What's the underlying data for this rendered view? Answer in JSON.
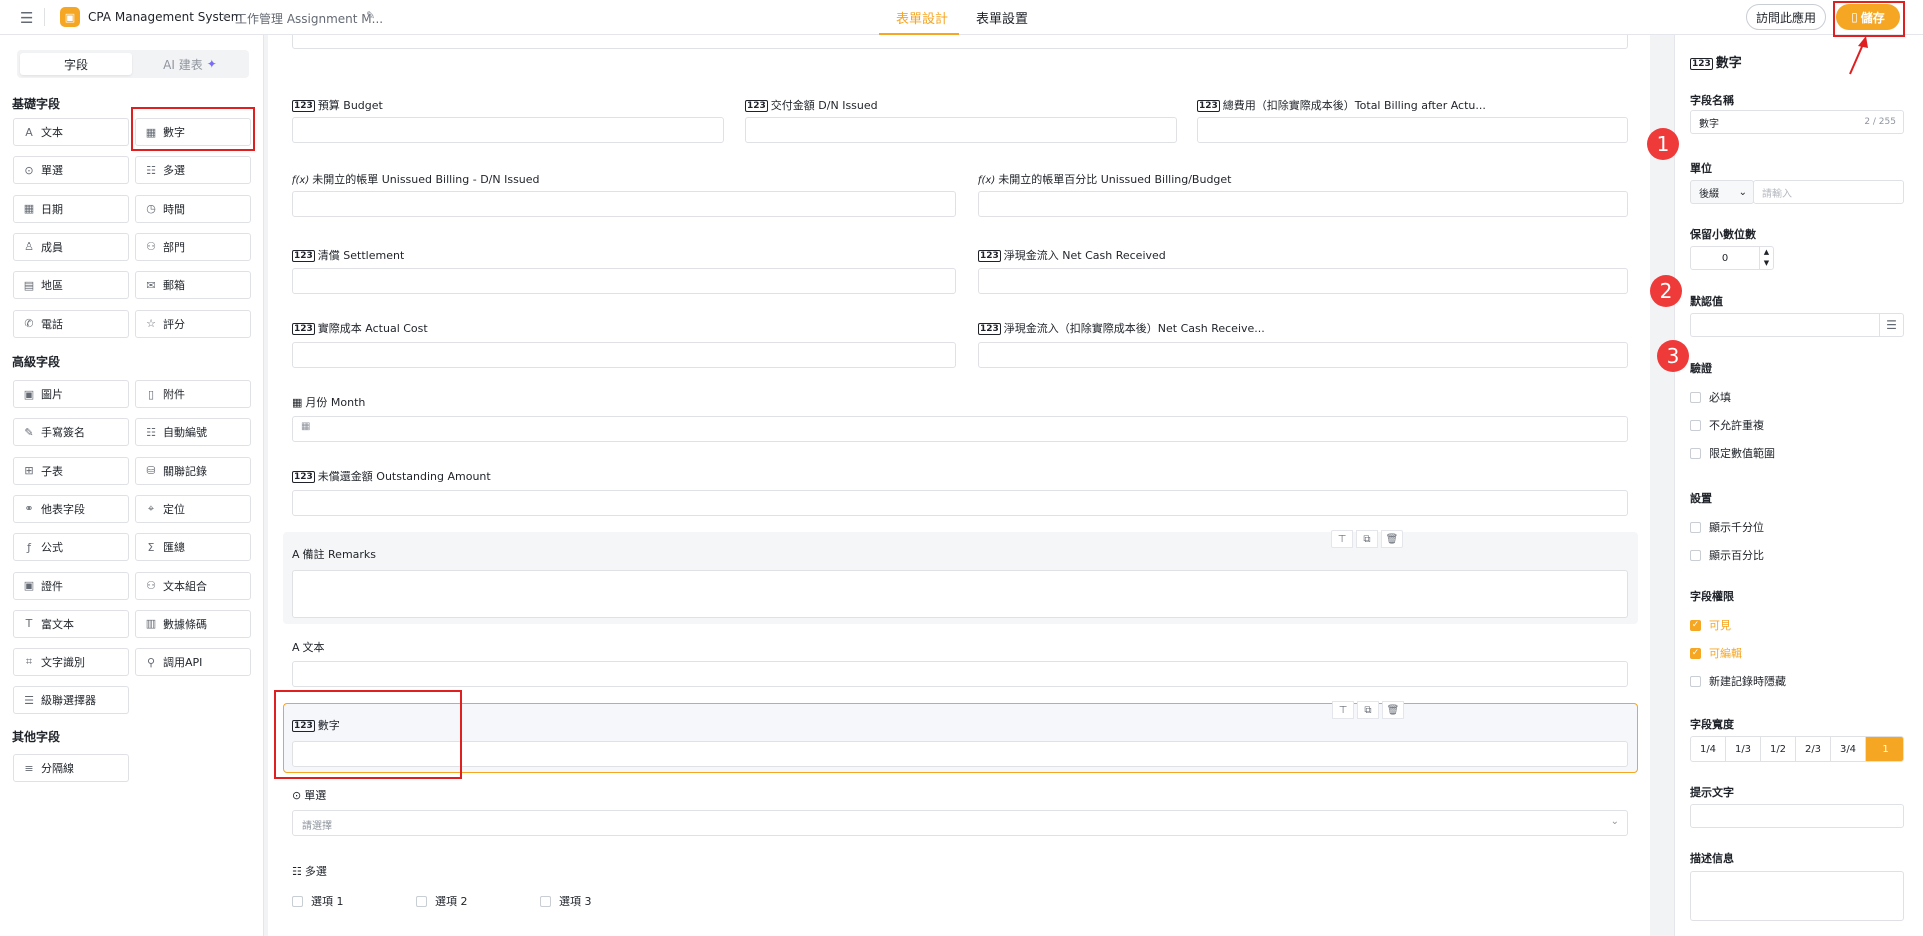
{
  "app": {
    "name": "CPA Management System",
    "form_title": "工作管理 Assignment M..."
  },
  "header": {
    "tabs": [
      "表單設計",
      "表單設置"
    ],
    "visit_label": "訪問此應用",
    "save_label": "儲存"
  },
  "left": {
    "tabs": [
      "字段",
      "AI 建表"
    ],
    "basic_title": "基礎字段",
    "basic": [
      "文本",
      "數字",
      "單選",
      "多選",
      "日期",
      "時間",
      "成員",
      "部門",
      "地區",
      "郵箱",
      "電話",
      "評分"
    ],
    "advanced_title": "高級字段",
    "advanced": [
      "圖片",
      "附件",
      "手寫簽名",
      "自動編號",
      "子表",
      "關聯記錄",
      "他表字段",
      "定位",
      "公式",
      "匯總",
      "證件",
      "文本組合",
      "富文本",
      "數據條碼",
      "文字識別",
      "調用API",
      "級聯選擇器"
    ],
    "other_title": "其他字段",
    "other": [
      "分隔線"
    ]
  },
  "canvas": {
    "fields": {
      "budget": "預算 Budget",
      "dn_issued": "交付金額 D/N Issued",
      "total_billing": "總費用（扣除實際成本後）Total Billing after Actu...",
      "unissued": "未開立的帳單 Unissued Billing - D/N Issued",
      "unissued_pct": "未開立的帳單百分比 Unissued Billing/Budget",
      "settlement": "清償 Settlement",
      "net_cash": "淨現金流入 Net Cash Received",
      "actual_cost": "實際成本 Actual Cost",
      "net_cash_after": "淨現金流入（扣除實際成本後）Net Cash Receive...",
      "month": "月份 Month",
      "outstanding": "未償還金額 Outstanding Amount",
      "remarks": "備註 Remarks",
      "text": "文本",
      "number": "數字",
      "single": "單選",
      "single_placeholder": "請選擇",
      "multi": "多選",
      "options": [
        "選項 1",
        "選項 2",
        "選項 3"
      ]
    }
  },
  "right": {
    "title": "數字",
    "field_name_label": "字段名稱",
    "field_name_value": "數字",
    "field_name_count": "2 / 255",
    "unit_label": "單位",
    "unit_select": "後綴",
    "unit_placeholder": "請輸入",
    "decimal_label": "保留小數位數",
    "decimal_value": "0",
    "default_label": "默認值",
    "validate_label": "驗證",
    "validate": [
      "必填",
      "不允許重複",
      "限定數值範圍"
    ],
    "settings_label": "設置",
    "settings": [
      "顯示千分位",
      "顯示百分比"
    ],
    "perm_label": "字段權限",
    "perms": [
      "可見",
      "可編輯",
      "新建記錄時隱藏"
    ],
    "width_label": "字段寬度",
    "widths": [
      "1/4",
      "1/3",
      "1/2",
      "2/3",
      "3/4",
      "1"
    ],
    "hint_label": "提示文字",
    "desc_label": "描述信息"
  },
  "annotations": [
    "1",
    "2",
    "3"
  ],
  "colors": {
    "accent": "#f5a623",
    "annotation": "#ef3a3a"
  }
}
